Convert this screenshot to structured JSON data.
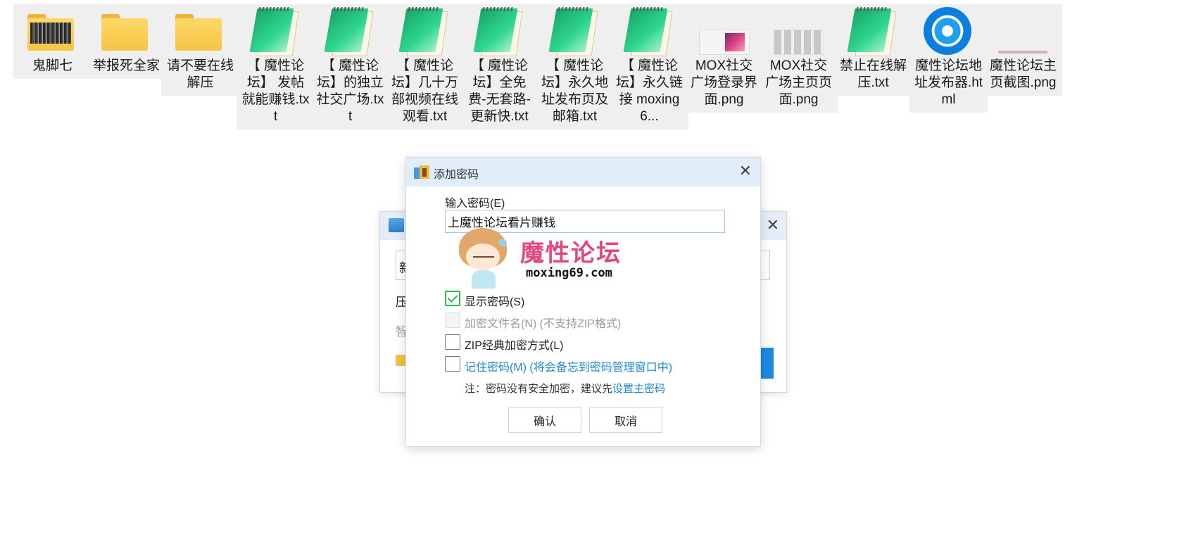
{
  "desktop": {
    "files": [
      {
        "label": "鬼脚七",
        "icon": "folder-icon"
      },
      {
        "label": "举报死全家",
        "icon": "folder-icon"
      },
      {
        "label": "请不要在线解压",
        "icon": "folder-icon"
      },
      {
        "label": "【 魔性论坛】 发帖就能赚钱.txt",
        "icon": "text-file-icon"
      },
      {
        "label": "【 魔性论坛】的独立社交广场.txt",
        "icon": "text-file-icon"
      },
      {
        "label": "【 魔性论坛】几十万部视频在线观看.txt",
        "icon": "text-file-icon"
      },
      {
        "label": "【 魔性论坛】全免费-无套路-更新快.txt",
        "icon": "text-file-icon"
      },
      {
        "label": "【 魔性论坛】永久地址发布页及邮箱.txt",
        "icon": "text-file-icon"
      },
      {
        "label": "【 魔性论坛】永久链接 moxing6...",
        "icon": "text-file-icon"
      },
      {
        "label": "MOX社交广场登录界面.png",
        "icon": "image-file-icon"
      },
      {
        "label": "MOX社交广场主页页面.png",
        "icon": "image-file-icon"
      },
      {
        "label": "禁止在线解压.txt",
        "icon": "text-file-icon"
      },
      {
        "label": "魔性论坛地址发布器.html",
        "icon": "browser-file-icon"
      },
      {
        "label": "魔性论坛主页截图.png",
        "icon": "image-file-icon"
      }
    ]
  },
  "back_window": {
    "field_char": "新",
    "label1": "压",
    "label2": "智"
  },
  "dialog": {
    "title": "添加密码",
    "close_icon": "close-icon",
    "password_label": "输入密码(E)",
    "password_value": "上魔性论坛看片赚钱",
    "watermark": {
      "brand": "魔性论坛",
      "url": "moxing69.com"
    },
    "options": {
      "show_password": {
        "label": "显示密码(S)",
        "checked": true
      },
      "encrypt_filenames": {
        "label": "加密文件名(N) (不支持ZIP格式)",
        "checked": false,
        "disabled": true
      },
      "zip_classic": {
        "label": "ZIP经典加密方式(L)",
        "checked": false
      },
      "remember_password": {
        "label": "记住密码(M) (将会备忘到密码管理窗口中)",
        "checked": false
      }
    },
    "note_prefix": "注：密码没有安全加密，建议先",
    "note_link": "设置主密码",
    "confirm_label": "确认",
    "cancel_label": "取消"
  },
  "colors": {
    "accent": "#1f86d6",
    "check": "#2fb84f",
    "titlebar": "#e1edf9",
    "brand": "#e4477d"
  }
}
